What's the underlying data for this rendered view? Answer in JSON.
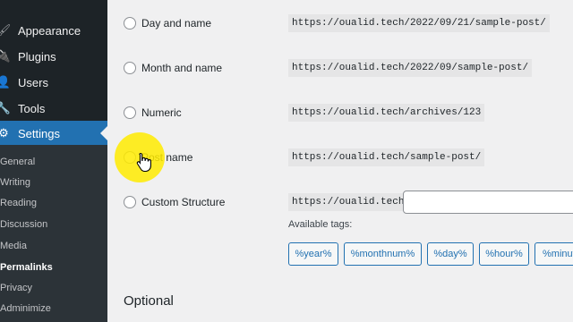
{
  "sidebar": {
    "menu": [
      {
        "label": "Appearance",
        "icon": "paintbrush-icon",
        "glyph": "🖌"
      },
      {
        "label": "Plugins",
        "icon": "plug-icon",
        "glyph": "🔌"
      },
      {
        "label": "Users",
        "icon": "user-icon",
        "glyph": "👤"
      },
      {
        "label": "Tools",
        "icon": "wrench-icon",
        "glyph": "🔧"
      },
      {
        "label": "Settings",
        "icon": "settings-sliders-icon",
        "glyph": "⚙"
      }
    ],
    "submenu": [
      "General",
      "Writing",
      "Reading",
      "Discussion",
      "Media",
      "Permalinks",
      "Privacy",
      "Adminimize"
    ],
    "current_submenu": "Permalinks",
    "active_menu": "Settings"
  },
  "permalink_options": [
    {
      "label": "Day and name",
      "example": "https://oualid.tech/2022/09/21/sample-post/"
    },
    {
      "label": "Month and name",
      "example": "https://oualid.tech/2022/09/sample-post/"
    },
    {
      "label": "Numeric",
      "example": "https://oualid.tech/archives/123"
    },
    {
      "label": "Post name",
      "example": "https://oualid.tech/sample-post/"
    },
    {
      "label": "Custom Structure",
      "example": "https://oualid.tech"
    }
  ],
  "custom_structure": {
    "value": ""
  },
  "available_tags_label": "Available tags:",
  "tags": [
    "%year%",
    "%monthnum%",
    "%day%",
    "%hour%",
    "%minute%"
  ],
  "optional_heading": "Optional",
  "colors": {
    "sidebar_bg": "#1d2327",
    "active": "#2271b1",
    "highlight": "#ffeb00"
  }
}
